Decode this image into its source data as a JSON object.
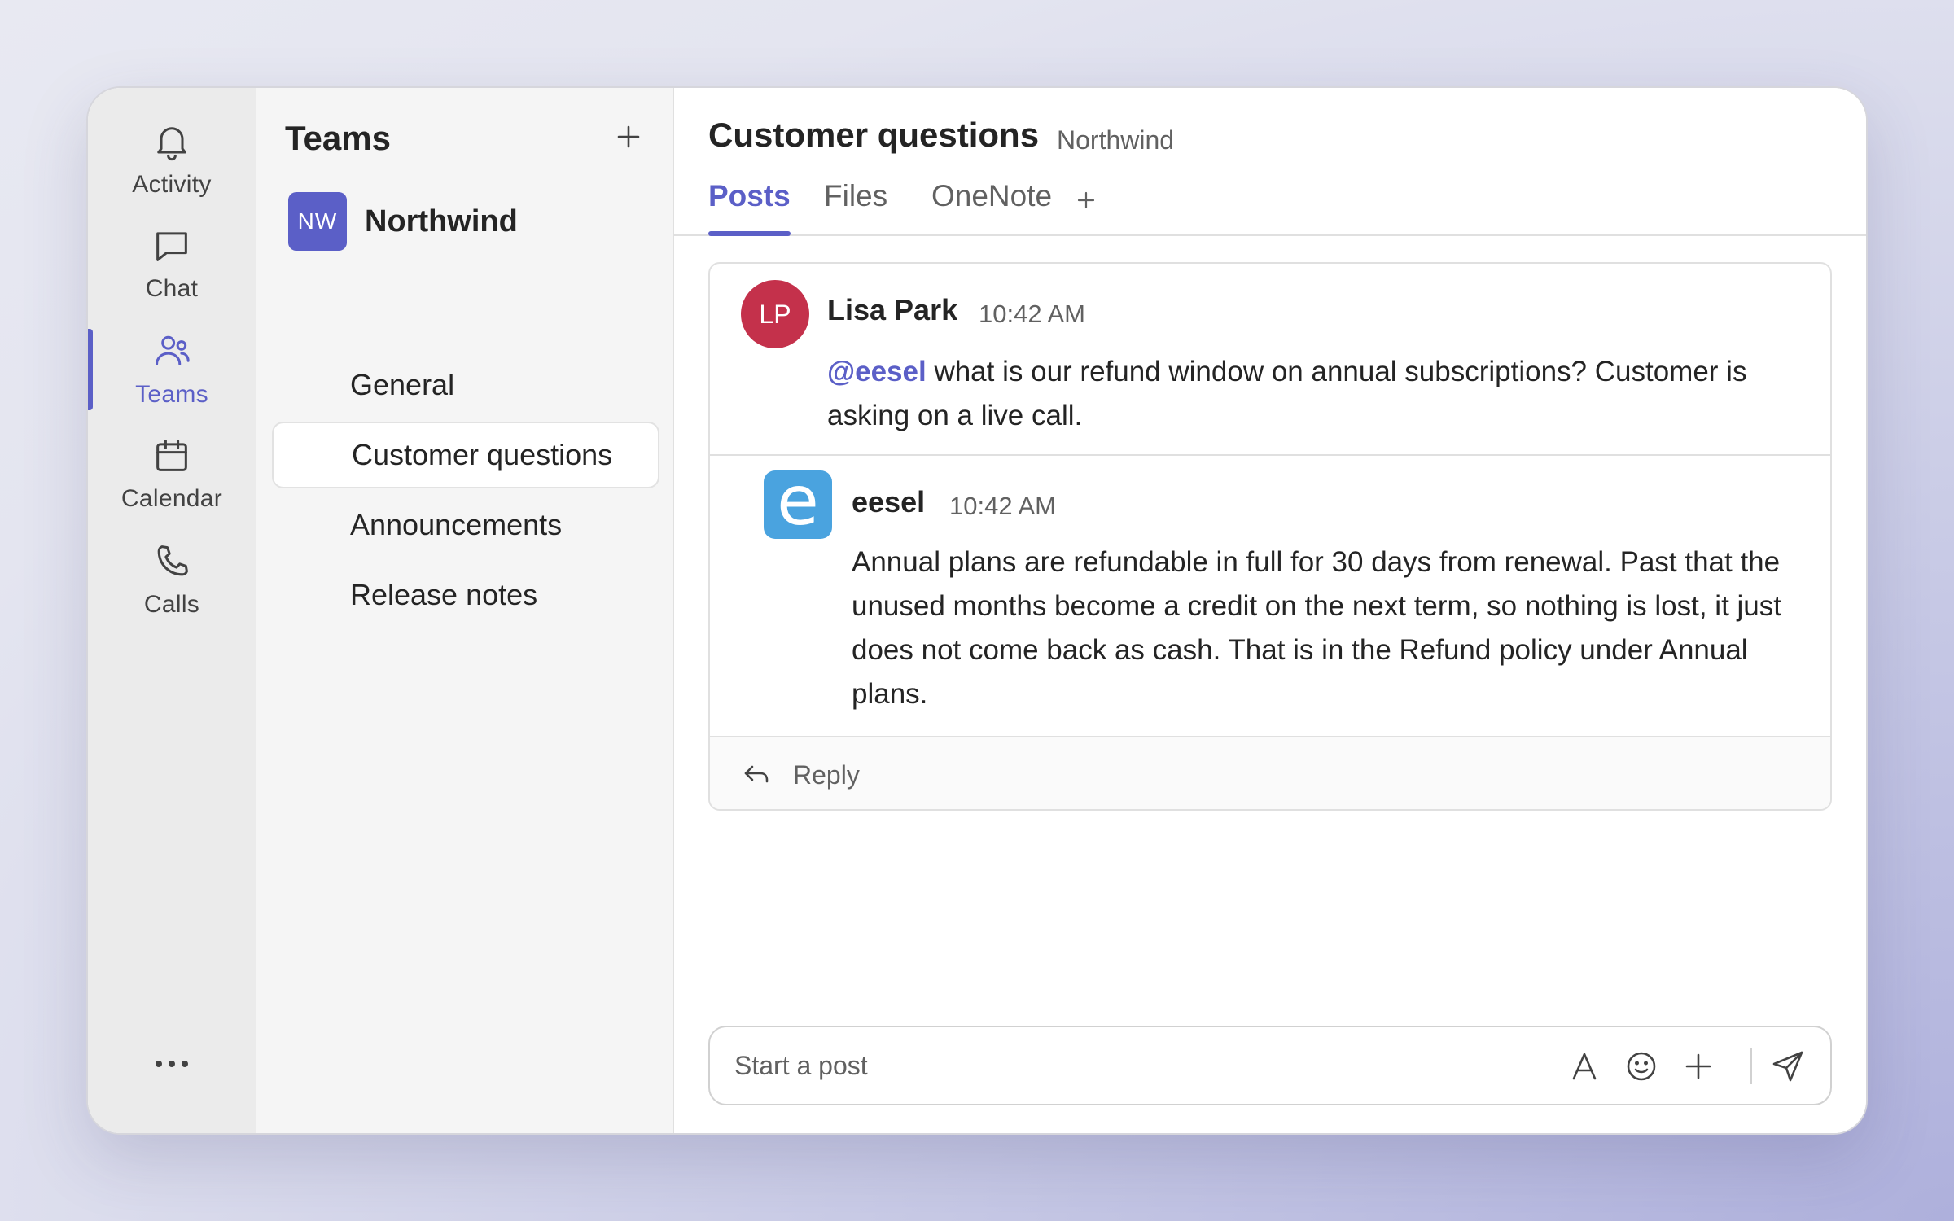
{
  "rail": {
    "items": [
      {
        "label": "Activity",
        "icon": "bell-icon"
      },
      {
        "label": "Chat",
        "icon": "chat-icon"
      },
      {
        "label": "Teams",
        "icon": "teams-icon",
        "active": true
      },
      {
        "label": "Calendar",
        "icon": "calendar-icon"
      },
      {
        "label": "Calls",
        "icon": "phone-icon"
      }
    ],
    "more_icon": "more-dots-icon"
  },
  "teams_panel": {
    "title": "Teams",
    "team": {
      "initials": "NW",
      "name": "Northwind"
    },
    "channels": [
      "General",
      "Customer questions",
      "Announcements",
      "Release notes"
    ],
    "active_channel": "Customer questions"
  },
  "channel_header": {
    "title": "Customer questions",
    "team": "Northwind",
    "tabs": [
      "Posts",
      "Files",
      "OneNote"
    ],
    "active_tab": "Posts"
  },
  "thread": {
    "message": {
      "initials": "LP",
      "author": "Lisa Park",
      "time": "10:42 AM",
      "mention": "@eesel",
      "text": " what is our refund window on annual subscriptions? Customer is asking on a live call."
    },
    "reply": {
      "avatar_letter": "e",
      "author": "eesel",
      "time": "10:42 AM",
      "text": "Annual plans are refundable in full for 30 days from renewal. Past that the unused months become a credit on the next term, so nothing is lost, it just does not come back as cash. That is in the Refund policy under Annual plans."
    },
    "reply_label": "Reply"
  },
  "compose": {
    "placeholder": "Start a post",
    "value": ""
  },
  "colors": {
    "accent": "#5b5fc7",
    "lp_avatar": "#c4314b",
    "eesel_avatar": "#4aa3df"
  }
}
